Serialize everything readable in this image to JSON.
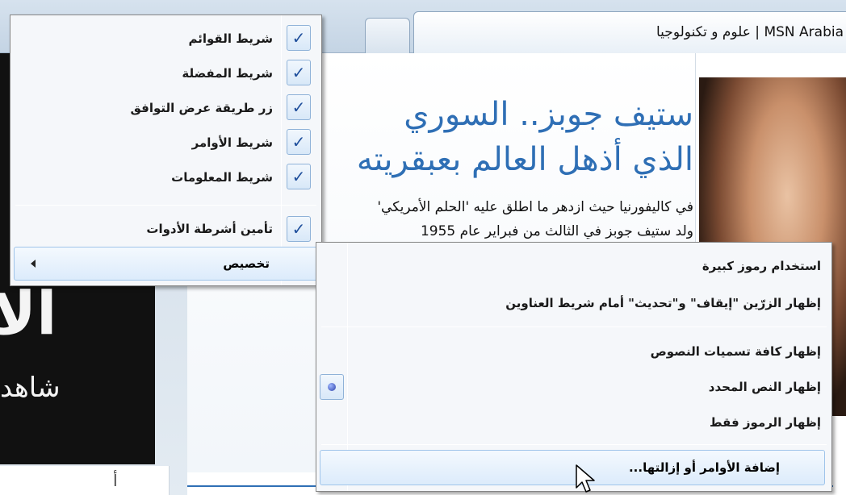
{
  "browser": {
    "active_tab_title": "MSN Arabia | علوم و تكنولوجيا"
  },
  "article": {
    "headline_line1": "ستيف جوبز.. السوري",
    "headline_line2": "الذي أذهل العالم بعبقريته",
    "summary_line1": "في كاليفورنيا حيث ازدهر ما اطلق عليه 'الحلم الأمريكي'",
    "summary_line2": "ولد ستيف جوبز في الثالث من فبراير عام 1955"
  },
  "ad": {
    "big_text": "الا",
    "sub_text": "شاهد",
    "below_text": "أ"
  },
  "toolbars_menu": {
    "items": [
      {
        "label": "شريط القوائم",
        "checked": true
      },
      {
        "label": "شريط المفضلة",
        "checked": true
      },
      {
        "label": "زر طريقة عرض التوافق",
        "checked": true
      },
      {
        "label": "شريط الأوامر",
        "checked": true
      },
      {
        "label": "شريط المعلومات",
        "checked": true
      }
    ],
    "lock_label": "تأمين أشرطة الأدوات",
    "lock_checked": true,
    "customize_label": "تخصيص"
  },
  "customize_menu": {
    "large_icons": "استخدام رموز كبيرة",
    "show_stop_refresh": "إظهار الزرّين \"إيقاف\" و\"تحديث\" أمام شريط العناوين",
    "show_all_text": "إظهار كافة تسميات النصوص",
    "show_selective_text": "إظهار النص المحدد",
    "show_icons_only": "إظهار الرموز فقط",
    "add_remove_commands": "إضافة الأوامر أو إزالتها...",
    "selected_option": "show_selective_text"
  },
  "colors": {
    "accent_blue": "#2f6fb5",
    "check_blue": "#1f4f9c",
    "menu_bg": "#f5f7fa"
  }
}
